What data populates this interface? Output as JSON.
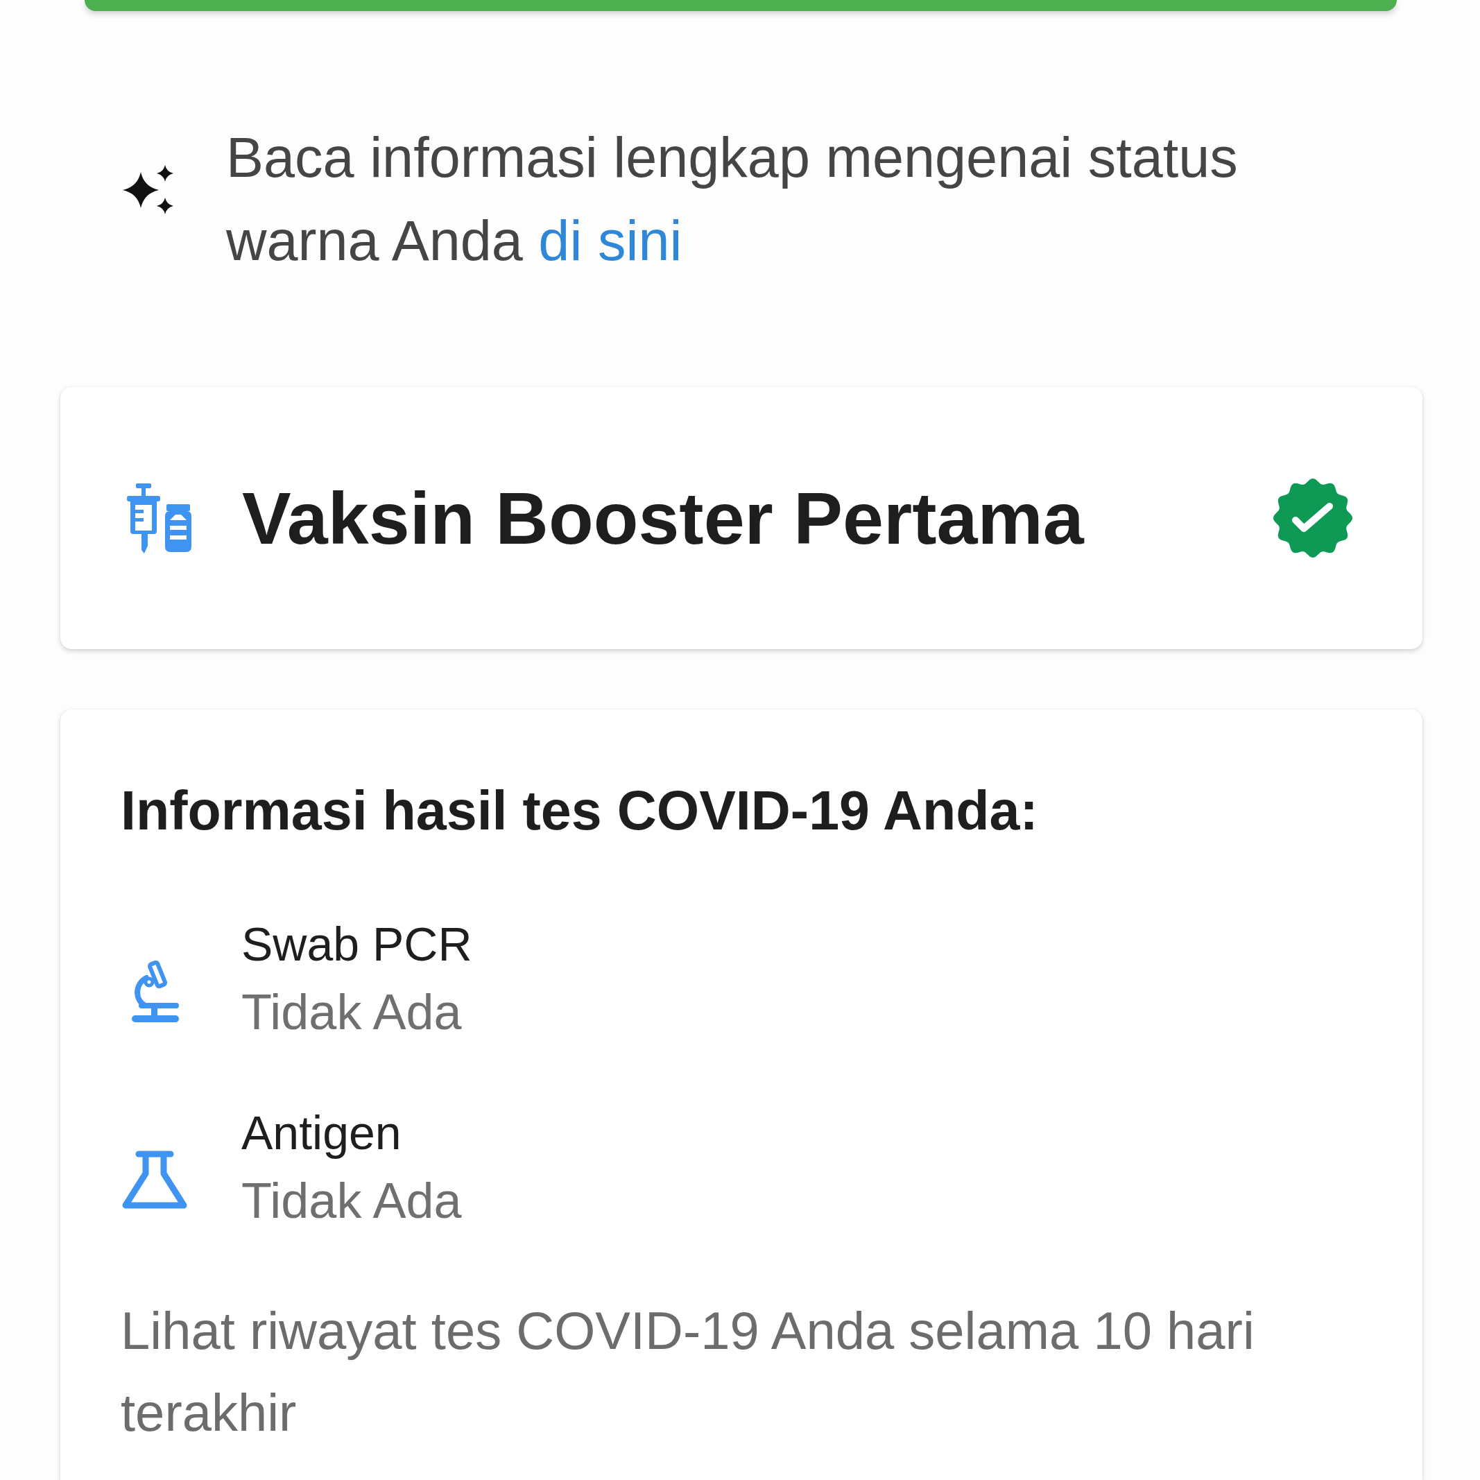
{
  "info": {
    "text": "Baca informasi lengkap mengenai status warna Anda",
    "link": "di sini"
  },
  "vaccine_card": {
    "title": "Vaksin Booster Pertama",
    "verified": true
  },
  "test_card": {
    "heading": "Informasi hasil tes COVID-19 Anda:",
    "tests": [
      {
        "kind": "pcr",
        "name": "Swab PCR",
        "result": "Tidak Ada"
      },
      {
        "kind": "antigen",
        "name": "Antigen",
        "result": "Tidak Ada"
      }
    ],
    "history_text": "Lihat riwayat tes COVID-19 Anda selama 10 hari terakhir"
  }
}
